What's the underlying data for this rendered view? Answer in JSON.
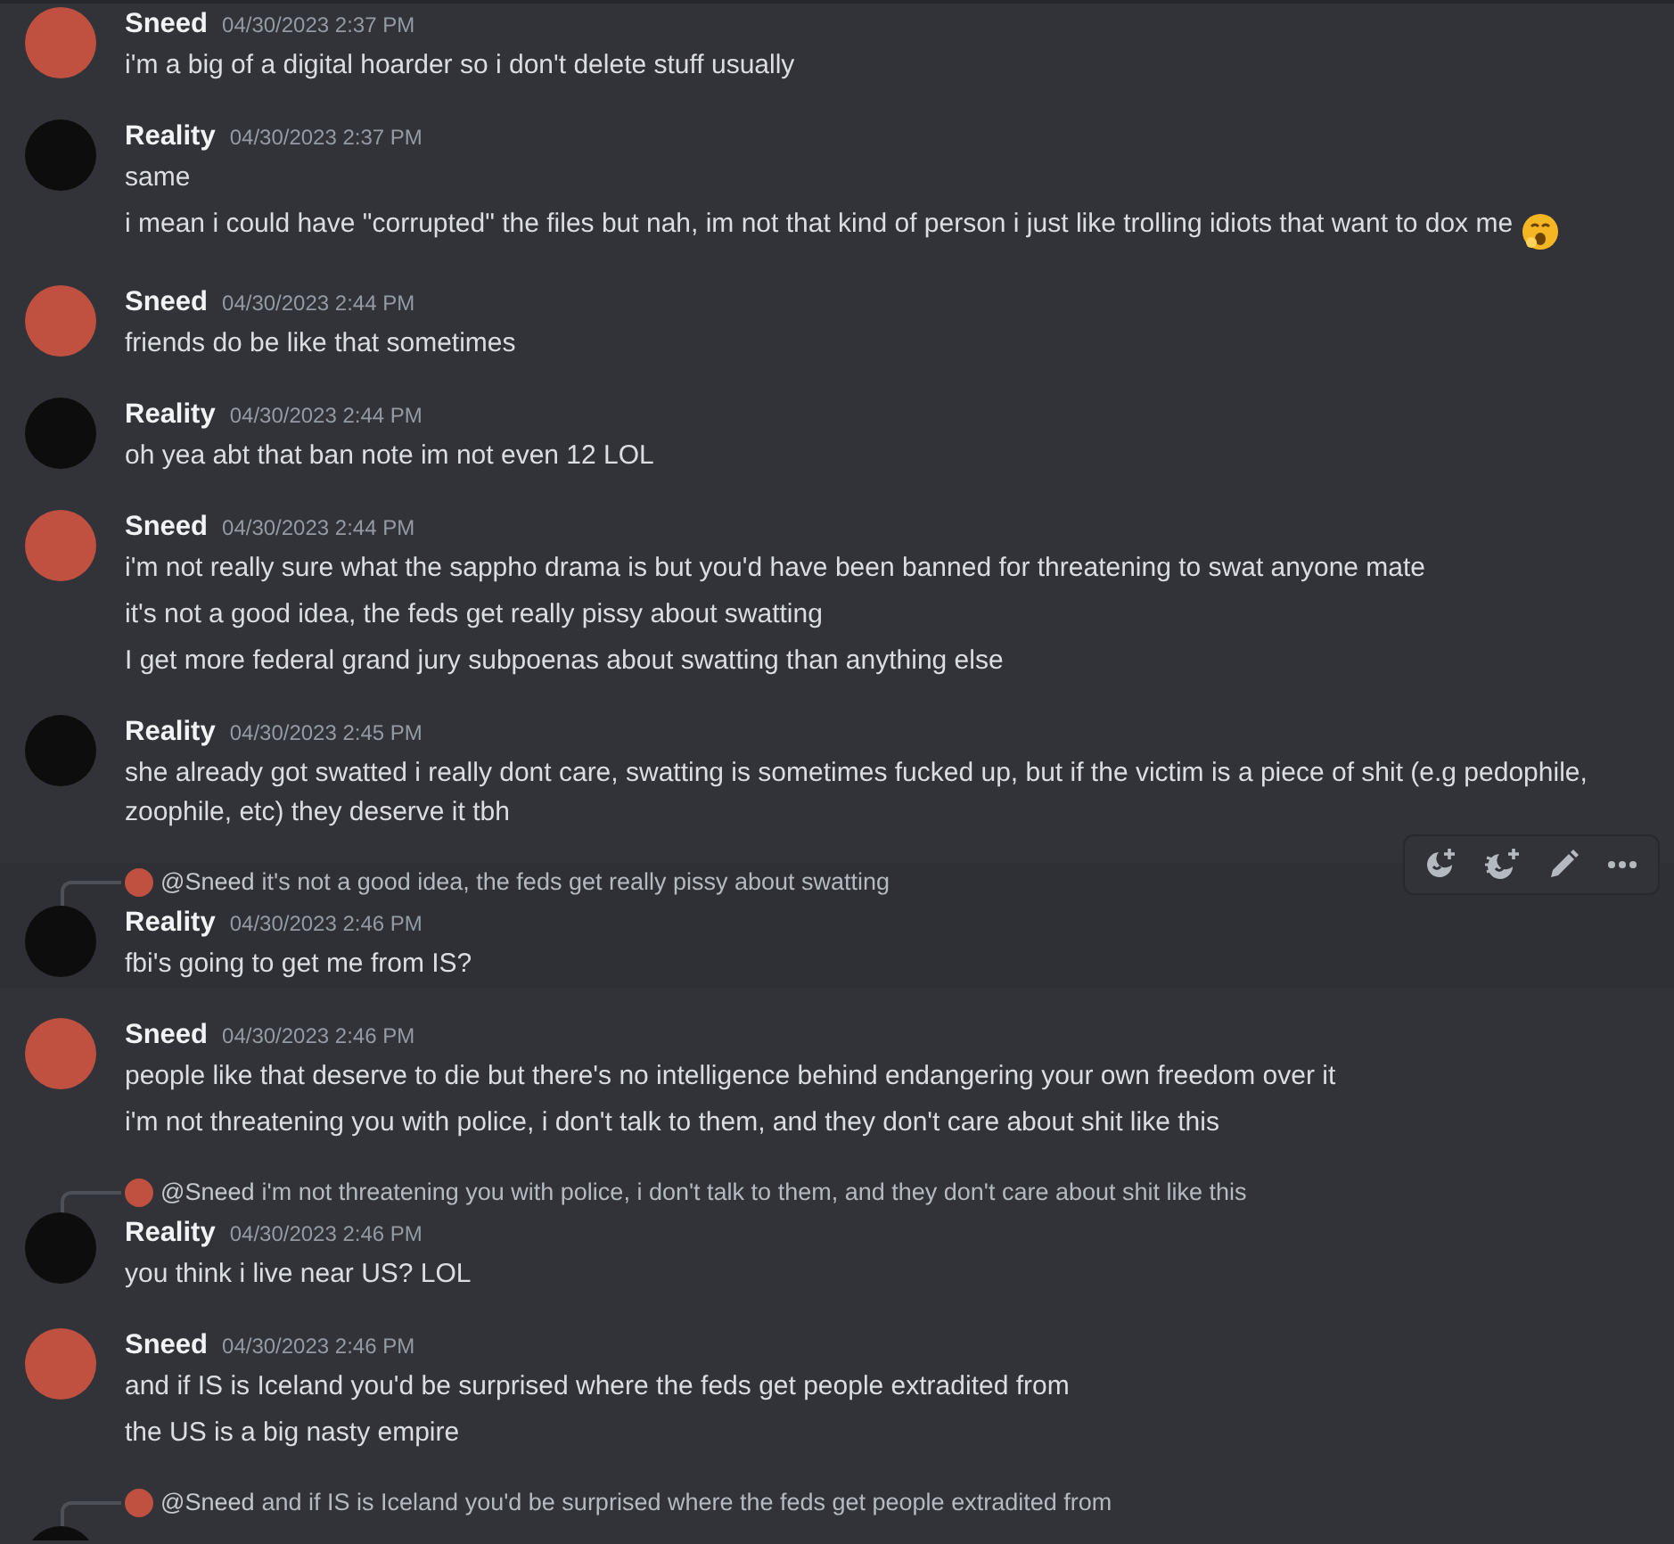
{
  "messages": [
    {
      "author": "Sneed",
      "timestamp": "04/30/2023 2:37 PM",
      "color": "#c0503f",
      "hovered": false,
      "lines": [
        "i'm a big of a digital hoarder so i don't delete stuff usually"
      ]
    },
    {
      "author": "Reality",
      "timestamp": "04/30/2023 2:37 PM",
      "color": "#0d0d0d",
      "hovered": false,
      "lines": [
        "same",
        "i mean i could have \"corrupted\" the files but nah, im not that kind of person i just like trolling idiots that want to dox me"
      ],
      "trailing_emoji": true
    },
    {
      "author": "Sneed",
      "timestamp": "04/30/2023 2:44 PM",
      "color": "#c0503f",
      "hovered": false,
      "lines": [
        "friends do be like that sometimes"
      ]
    },
    {
      "author": "Reality",
      "timestamp": "04/30/2023 2:44 PM",
      "color": "#0d0d0d",
      "hovered": false,
      "lines": [
        "oh yea abt that ban note im not even 12 LOL"
      ]
    },
    {
      "author": "Sneed",
      "timestamp": "04/30/2023 2:44 PM",
      "color": "#c0503f",
      "hovered": false,
      "lines": [
        "i'm not really sure what the sappho drama is but you'd have been banned for threatening to swat anyone mate",
        "it's not a good idea, the feds get really pissy about swatting",
        "I get more federal grand jury subpoenas about swatting than anything else"
      ]
    },
    {
      "author": "Reality",
      "timestamp": "04/30/2023 2:45 PM",
      "color": "#0d0d0d",
      "hovered": false,
      "lines": [
        "she already got swatted i really dont care, swatting is sometimes fucked up, but if the victim is a piece of shit (e.g pedophile, zoophile, etc) they deserve it tbh"
      ]
    },
    {
      "author": "Reality",
      "timestamp": "04/30/2023 2:46 PM",
      "color": "#0d0d0d",
      "hovered": true,
      "reply": {
        "author": "@Sneed",
        "text": "it's not a good idea, the feds get really pissy about swatting",
        "color": "#c0503f"
      },
      "lines": [
        "fbi's going to get me from IS?"
      ]
    },
    {
      "author": "Sneed",
      "timestamp": "04/30/2023 2:46 PM",
      "color": "#c0503f",
      "hovered": false,
      "lines": [
        "people like that deserve to die but there's no intelligence behind endangering your own freedom over it",
        "i'm not threatening you with police, i don't talk to them, and they don't care about shit like this"
      ]
    },
    {
      "author": "Reality",
      "timestamp": "04/30/2023 2:46 PM",
      "color": "#0d0d0d",
      "hovered": false,
      "reply": {
        "author": "@Sneed",
        "text": "i'm not threatening you with police, i don't talk to them, and they don't care about shit like this",
        "color": "#c0503f"
      },
      "lines": [
        "you think i live near US? LOL"
      ]
    },
    {
      "author": "Sneed",
      "timestamp": "04/30/2023 2:46 PM",
      "color": "#c0503f",
      "hovered": false,
      "lines": [
        "and if IS is Iceland you'd be surprised where the feds get people extradited from",
        "the US is a big nasty empire"
      ]
    },
    {
      "color": "#0d0d0d",
      "hovered": false,
      "reply": {
        "author": "@Sneed",
        "text": "and if IS is Iceland you'd be surprised where the feds get people extradited from",
        "color": "#c0503f"
      }
    }
  ]
}
